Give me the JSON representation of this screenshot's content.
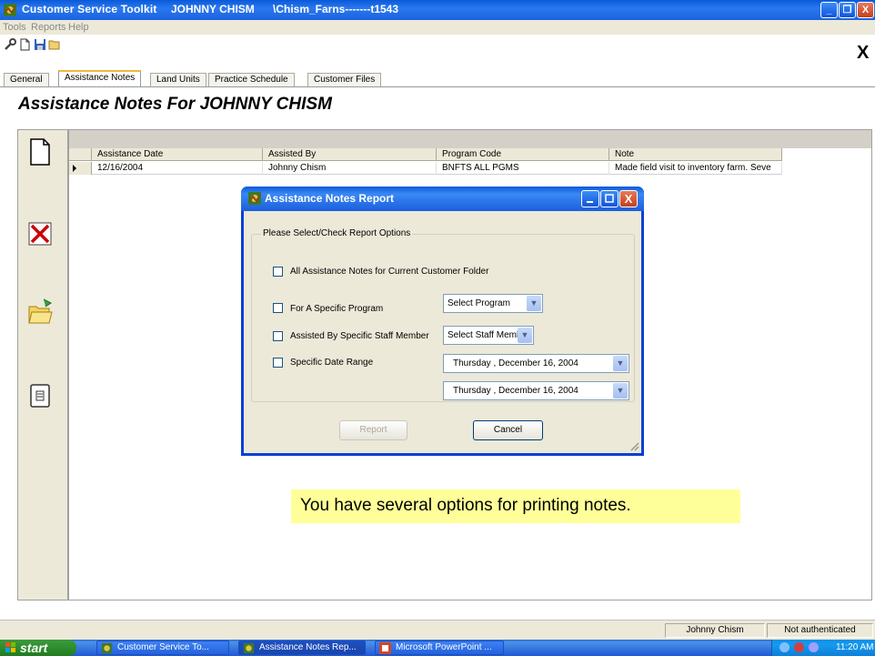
{
  "window": {
    "title": "Customer Service Toolkit",
    "user": "JOHNNY CHISM",
    "path": "\\Chism_Farns-------t1543",
    "min_label": "_",
    "max_label": "❐",
    "close_label": "X"
  },
  "menu": {
    "items": [
      "Tools",
      "Reports",
      "Help"
    ]
  },
  "toolbar": {
    "icons": [
      "wrench-icon",
      "new-document-icon",
      "save-icon",
      "open-folder-icon"
    ],
    "close_label": "X"
  },
  "tabs": [
    "General",
    "Assistance Notes",
    "Land Units",
    "Practice Schedule",
    "Customer Files"
  ],
  "active_tab": "Assistance Notes",
  "page_title": "Assistance Notes For   JOHNNY CHISM",
  "left_panel": {
    "icons": [
      "new-note-icon",
      "delete-note-icon",
      "open-folder-icon",
      "report-icon"
    ]
  },
  "grid": {
    "columns": [
      "Assistance Date",
      "Assisted By",
      "Program Code",
      "Note"
    ],
    "rows": [
      [
        "12/16/2004",
        "Johnny Chism",
        "BNFTS ALL PGMS",
        "Made field visit to inventory farm. Seve"
      ]
    ]
  },
  "dialog": {
    "title": "Assistance Notes Report",
    "group_label": "Please Select/Check Report Options",
    "options": {
      "all": "All Assistance Notes for Current Customer Folder",
      "program": "For A Specific Program",
      "staff": "Assisted By Specific Staff Member",
      "date": "Specific Date Range"
    },
    "program_select": "Select Program",
    "staff_select": "Select Staff Member",
    "date_from": "Thursday   , December 16, 2004",
    "date_to": "Thursday   , December 16, 2004",
    "report_button": "Report",
    "cancel_button": "Cancel"
  },
  "callout": "You have several options for printing notes.",
  "status": {
    "user": "Johnny Chism",
    "auth": "Not authenticated"
  },
  "taskbar": {
    "start": "start",
    "tasks": [
      "Customer Service To...",
      "Assistance Notes Rep...",
      "Microsoft PowerPoint ..."
    ],
    "clock": "11:20 AM"
  },
  "colors": {
    "title_blue": "#0a59d8",
    "callout_yellow": "#ffff99",
    "xp_beige": "#ece9d8",
    "delete_red": "#cc0000"
  }
}
